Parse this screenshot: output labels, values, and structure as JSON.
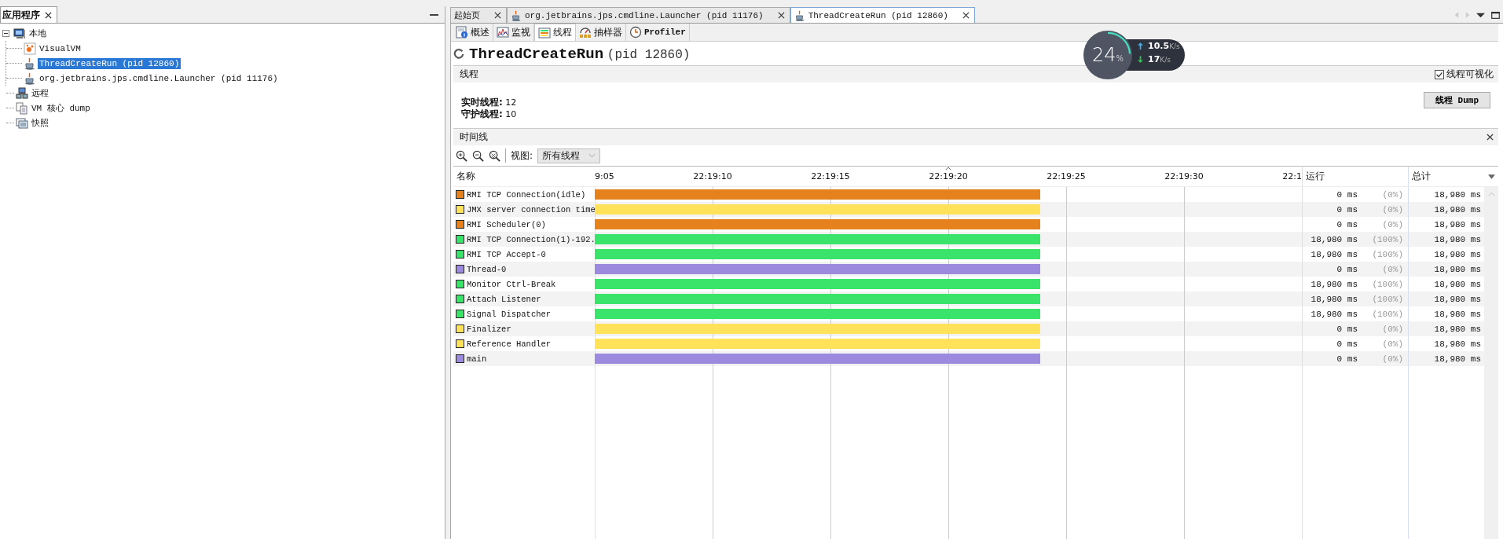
{
  "left_panel": {
    "title": "应用程序",
    "tree": [
      {
        "label": "本地",
        "kind": "computer",
        "selected": false,
        "expanded": true,
        "children": [
          {
            "label": "VisualVM",
            "kind": "visualvm",
            "selected": false
          },
          {
            "label": "ThreadCreateRun (pid 12860)",
            "kind": "java",
            "selected": true
          },
          {
            "label": "org.jetbrains.jps.cmdline.Launcher (pid 11176)",
            "kind": "java",
            "selected": false
          }
        ]
      },
      {
        "label": "远程",
        "kind": "remote",
        "selected": false
      },
      {
        "label": "VM 核心 dump",
        "kind": "dump",
        "selected": false
      },
      {
        "label": "快照",
        "kind": "snapshot",
        "selected": false
      }
    ]
  },
  "editor_tabs": [
    {
      "label": "起始页",
      "kind": "start",
      "selected": false
    },
    {
      "label": "org.jetbrains.jps.cmdline.Launcher (pid 11176)",
      "kind": "java",
      "selected": false
    },
    {
      "label": "ThreadCreateRun (pid 12860)",
      "kind": "java",
      "selected": true
    }
  ],
  "view_tabs": [
    {
      "label": "概述",
      "kind": "overview",
      "selected": false
    },
    {
      "label": "监视",
      "kind": "monitor",
      "selected": false
    },
    {
      "label": "线程",
      "kind": "threads",
      "selected": true
    },
    {
      "label": "抽样器",
      "kind": "sampler",
      "selected": false
    },
    {
      "label": "Profiler",
      "kind": "profiler",
      "selected": false
    }
  ],
  "app_title": {
    "name": "ThreadCreateRun",
    "pid": "(pid 12860)"
  },
  "threads_section": {
    "title": "线程",
    "visualize": {
      "label": "线程可视化",
      "checked": true
    },
    "stats": [
      {
        "label": "实时线程:",
        "value": "12"
      },
      {
        "label": "守护线程:",
        "value": "10"
      }
    ],
    "dump_button": "线程 Dump"
  },
  "timeline": {
    "title": "时间线",
    "view_label": "视图:",
    "view_value": "所有线程",
    "columns": [
      "名称",
      "运行",
      "总计"
    ],
    "ticks": [
      "9:05",
      "22:19:10",
      "22:19:15",
      "22:19:20",
      "22:19:25",
      "22:19:30",
      "22:1"
    ],
    "rows": [
      {
        "name": "RMI TCP Connection(idle)",
        "color": "#e6821e",
        "level": 0.63,
        "running": "0 ms",
        "percent": "(0%)",
        "total": "18,980 ms"
      },
      {
        "name": "JMX server connection time",
        "color": "#ffe15a",
        "level": 0.63,
        "running": "0 ms",
        "percent": "(0%)",
        "total": "18,980 ms"
      },
      {
        "name": "RMI Scheduler(0)",
        "color": "#e6821e",
        "level": 0.63,
        "running": "0 ms",
        "percent": "(0%)",
        "total": "18,980 ms"
      },
      {
        "name": "RMI TCP Connection(1)-192.",
        "color": "#3ae46a",
        "level": 0.63,
        "running": "18,980 ms",
        "percent": "(100%)",
        "total": "18,980 ms"
      },
      {
        "name": "RMI TCP Accept-0",
        "color": "#3ae46a",
        "level": 0.63,
        "running": "18,980 ms",
        "percent": "(100%)",
        "total": "18,980 ms"
      },
      {
        "name": "Thread-0",
        "color": "#9b8ade",
        "level": 0.63,
        "running": "0 ms",
        "percent": "(0%)",
        "total": "18,980 ms"
      },
      {
        "name": "Monitor Ctrl-Break",
        "color": "#3ae46a",
        "level": 0.63,
        "running": "18,980 ms",
        "percent": "(100%)",
        "total": "18,980 ms"
      },
      {
        "name": "Attach Listener",
        "color": "#3ae46a",
        "level": 0.63,
        "running": "18,980 ms",
        "percent": "(100%)",
        "total": "18,980 ms"
      },
      {
        "name": "Signal Dispatcher",
        "color": "#3ae46a",
        "level": 0.63,
        "running": "18,980 ms",
        "percent": "(100%)",
        "total": "18,980 ms"
      },
      {
        "name": "Finalizer",
        "color": "#ffe15a",
        "level": 0.63,
        "running": "0 ms",
        "percent": "(0%)",
        "total": "18,980 ms"
      },
      {
        "name": "Reference Handler",
        "color": "#ffe15a",
        "level": 0.63,
        "running": "0 ms",
        "percent": "(0%)",
        "total": "18,980 ms"
      },
      {
        "name": "main",
        "color": "#9b8ade",
        "level": 0.63,
        "running": "0 ms",
        "percent": "(0%)",
        "total": "18,980 ms"
      }
    ]
  },
  "meter": {
    "percent": "24",
    "unit": "%",
    "level": 0.24,
    "up": "10.5",
    "up_unit": "K/s",
    "down": "17",
    "down_unit": "K/s"
  }
}
